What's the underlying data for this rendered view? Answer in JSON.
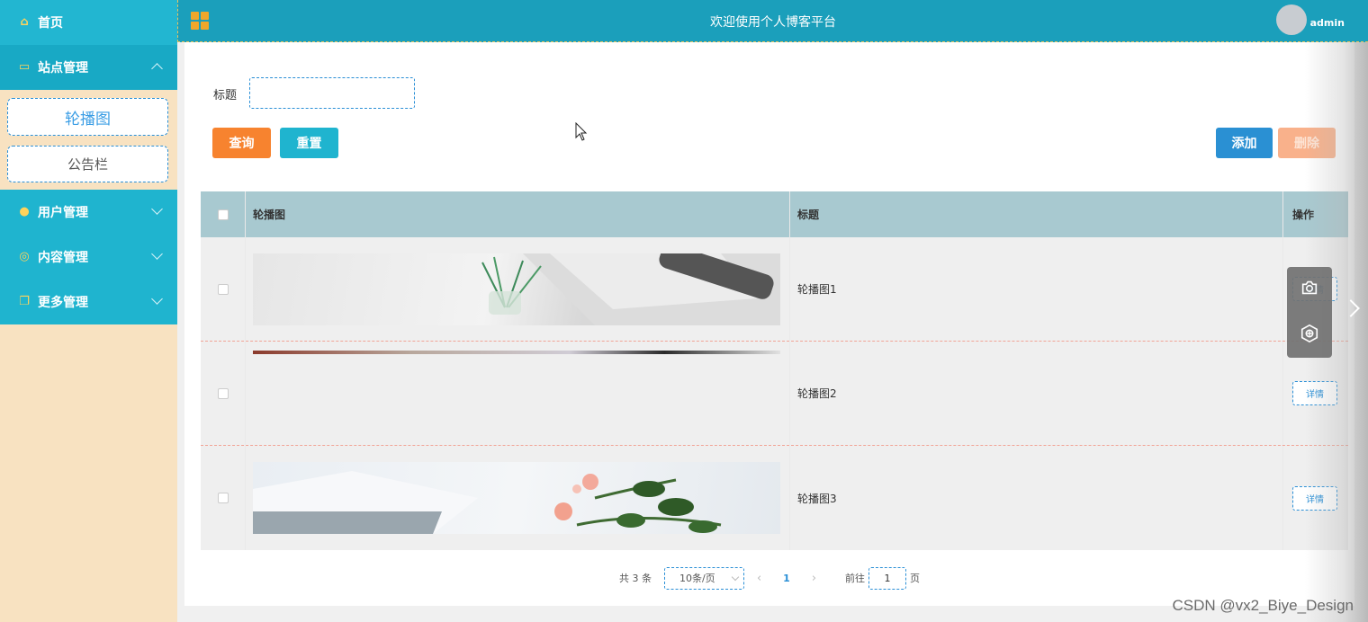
{
  "sidebar": {
    "items": [
      {
        "label": "首页",
        "icon": "home-icon"
      },
      {
        "label": "站点管理",
        "icon": "monitor-icon",
        "expanded": true,
        "children": [
          {
            "label": "轮播图",
            "active": true
          },
          {
            "label": "公告栏",
            "active": false
          }
        ]
      },
      {
        "label": "用户管理",
        "icon": "user-icon"
      },
      {
        "label": "内容管理",
        "icon": "chat-icon"
      },
      {
        "label": "更多管理",
        "icon": "copy-icon"
      }
    ]
  },
  "header": {
    "title": "欢迎使用个人博客平台",
    "username": "admin"
  },
  "search": {
    "label": "标题",
    "value": "",
    "query_label": "查询",
    "reset_label": "重置"
  },
  "actions": {
    "add_label": "添加",
    "delete_label": "删除"
  },
  "table": {
    "columns": [
      "轮播图",
      "标题",
      "操作"
    ],
    "rows": [
      {
        "title": "轮播图1",
        "action": "详情"
      },
      {
        "title": "轮播图2",
        "action": "详情"
      },
      {
        "title": "轮播图3",
        "action": "详情"
      }
    ]
  },
  "pager": {
    "total": "共 3 条",
    "page_size": "10条/页",
    "current_page": "1",
    "goto_prefix": "前往",
    "goto_value": "1",
    "goto_suffix": "页"
  },
  "watermark": "CSDN @vx2_Biye_Design",
  "colors": {
    "primary": "#1fb4cf",
    "header": "#1b9fbb",
    "sidebar_bg": "#f8e2c1",
    "query": "#f7832f",
    "add": "#2a90d3",
    "delete": "#f9b18b"
  }
}
